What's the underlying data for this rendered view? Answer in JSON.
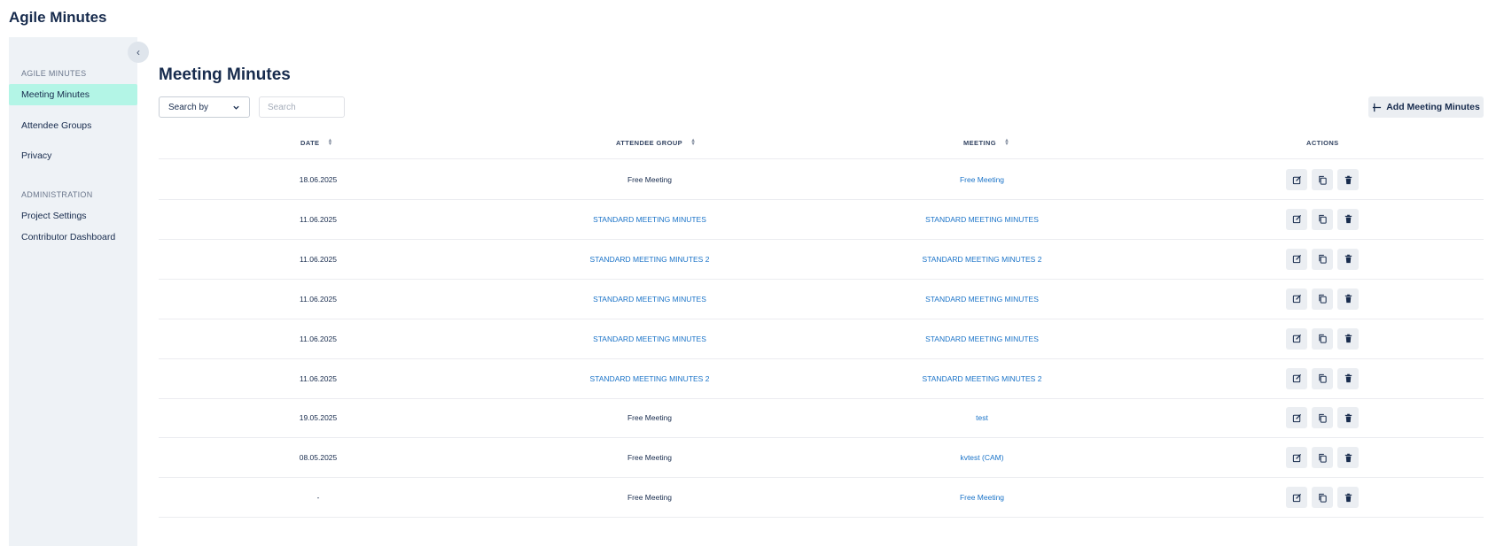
{
  "app": {
    "title": "Agile Minutes"
  },
  "sidebar": {
    "collapse_label": "‹",
    "section1": "AGILE MINUTES",
    "items1": [
      {
        "label": "Meeting Minutes",
        "active": true
      },
      {
        "label": "Attendee Groups",
        "active": false
      },
      {
        "label": "Privacy",
        "active": false
      }
    ],
    "section2": "ADMINISTRATION",
    "items2": [
      {
        "label": "Project Settings"
      },
      {
        "label": "Contributor Dashboard"
      }
    ]
  },
  "main": {
    "title": "Meeting Minutes",
    "search_by": "Search by",
    "search_placeholder": "Search",
    "add_button": "Add Meeting Minutes",
    "columns": [
      "DATE",
      "ATTENDEE GROUP",
      "MEETING",
      "ACTIONS"
    ]
  },
  "rows": [
    {
      "date": "18.06.2025",
      "group": "Free Meeting",
      "group_link": false,
      "meeting": "Free Meeting"
    },
    {
      "date": "11.06.2025",
      "group": "STANDARD MEETING MINUTES",
      "group_link": true,
      "meeting": "STANDARD MEETING MINUTES"
    },
    {
      "date": "11.06.2025",
      "group": "STANDARD MEETING MINUTES 2",
      "group_link": true,
      "meeting": "STANDARD MEETING MINUTES 2"
    },
    {
      "date": "11.06.2025",
      "group": "STANDARD MEETING MINUTES",
      "group_link": true,
      "meeting": "STANDARD MEETING MINUTES"
    },
    {
      "date": "11.06.2025",
      "group": "STANDARD MEETING MINUTES",
      "group_link": true,
      "meeting": "STANDARD MEETING MINUTES"
    },
    {
      "date": "11.06.2025",
      "group": "STANDARD MEETING MINUTES 2",
      "group_link": true,
      "meeting": "STANDARD MEETING MINUTES 2"
    },
    {
      "date": "19.05.2025",
      "group": "Free Meeting",
      "group_link": false,
      "meeting": "test"
    },
    {
      "date": "08.05.2025",
      "group": "Free Meeting",
      "group_link": false,
      "meeting": "kvtest (CAM)"
    },
    {
      "date": "-",
      "group": "Free Meeting",
      "group_link": false,
      "meeting": "Free Meeting"
    }
  ],
  "icons": {
    "edit": "edit-icon",
    "copy": "copy-icon",
    "delete": "trash-icon",
    "add": "plus-icon",
    "sort": "sort-icon"
  },
  "colors": {
    "active_nav": "#b3f5e6",
    "link": "#1a73c8",
    "sidebar_bg": "#eef2f6"
  }
}
